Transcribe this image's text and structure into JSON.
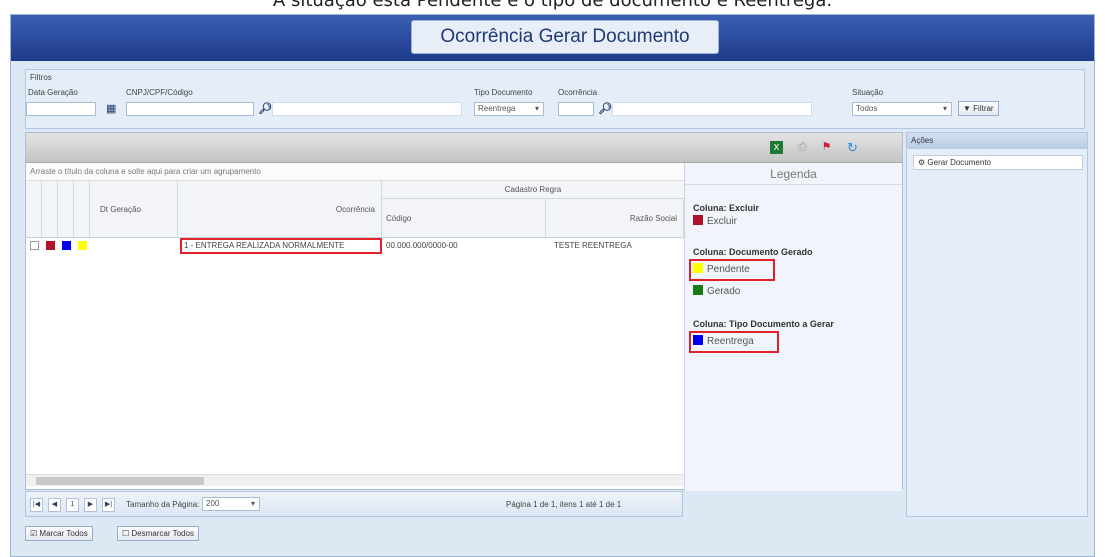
{
  "caption": "A situação está Pendente e o tipo de documento é Reentrega.",
  "window_title": "Ocorrência Gerar Documento",
  "filters": {
    "section_label": "Filtros",
    "data_geracao_label": "Data Geração",
    "cnpj_label": "CNPJ/CPF/Código",
    "tipo_documento_label": "Tipo Documento",
    "tipo_documento_value": "Reentrega",
    "ocorrencia_label": "Ocorrência",
    "situacao_label": "Situação",
    "situacao_value": "Todos",
    "filtrar_label": "Filtrar"
  },
  "grid": {
    "group_hint": "Arraste o título da coluna e solte aqui para criar um agrupamento",
    "col_dt_geracao": "Dt Geração",
    "col_ocorrencia": "Ocorrência",
    "col_group_cadastro": "Cadastro Regra",
    "col_codigo": "Código",
    "col_razao_social": "Razão Social",
    "rows": [
      {
        "dt_geracao": "",
        "ocorrencia": "1 - ENTREGA REALIZADA NORMALMENTE",
        "codigo": "00.000.000/0000-00",
        "razao_social": "TESTE REENTREGA"
      }
    ]
  },
  "legend": {
    "title": "Legenda",
    "section_excluir": "Coluna: Excluir",
    "item_excluir": "Excluir",
    "section_documento": "Coluna: Documento Gerado",
    "item_pendente": "Pendente",
    "item_gerado": "Gerado",
    "section_tipo": "Coluna: Tipo Documento a Gerar",
    "item_reentrega": "Reentrega"
  },
  "pager": {
    "page_value": "1",
    "page_size_label": "Tamanho da Página:",
    "page_size_value": "200",
    "summary": "Página 1 de 1, itens 1 até 1 de 1"
  },
  "actions": {
    "header": "Ações",
    "gerar_documento": "Gerar Documento"
  },
  "bottom": {
    "marcar_todos": "Marcar Todos",
    "desmarcar_todos": "Desmarcar Todos"
  },
  "colors": {
    "banner": "#1e3a8a",
    "pendente": "#ffff00",
    "gerado": "#1a7a1a",
    "reentrega": "#0000ee",
    "excluir": "#b0122b",
    "highlight": "#e0202a"
  }
}
